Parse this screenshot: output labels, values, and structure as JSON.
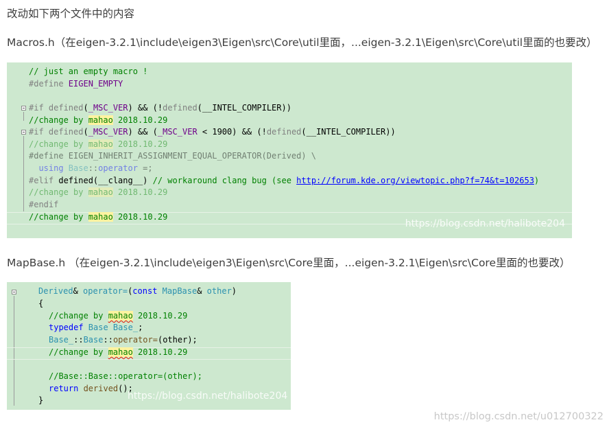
{
  "intro": "改动如下两个文件中的内容",
  "file1": {
    "heading": "Macros.h（在eigen-3.2.1\\include\\eigen3\\Eigen\\src\\Core\\util里面，...eigen-3.2.1\\Eigen\\src\\Core\\util里面的也要改）",
    "code": {
      "l1": "// just an empty macro !",
      "l2_kw": "#define",
      "l2_name": " EIGEN_EMPTY",
      "l4_kw": "#if",
      "l4_def": " defined",
      "l4_a": "(",
      "l4_m1": "_MSC_VER",
      "l4_b": ") && (!",
      "l4_def2": "defined",
      "l4_c": "(__INTEL_COMPILER))",
      "l5_a": "//change by ",
      "l5_hl": "mahao",
      "l5_b": " 2018.10.29",
      "l6_kw": "#if",
      "l6_def": " defined",
      "l6_a": "(",
      "l6_m1": "_MSC_VER",
      "l6_b": ") && (",
      "l6_m2": "_MSC_VER",
      "l6_c": " < 1900) && (!",
      "l6_def2": "defined",
      "l6_d": "(__INTEL_COMPILER))",
      "l7_a": "//change by ",
      "l7_hl": "mahao",
      "l7_b": " 2018.10.29",
      "l8": "#define EIGEN_INHERIT_ASSIGNMENT_EQUAL_OPERATOR(Derived) \\",
      "l9_kw": "  using",
      "l9_type": " Base",
      "l9_a": "::",
      "l9_fn": "operator",
      "l9_b": " =;",
      "l10_kw": "#elif",
      "l10_a": " defined(__clang__) ",
      "l10_cm": "// workaround clang bug (see ",
      "l10_link": "http://forum.kde.org/viewtopic.php?f=74&t=102653",
      "l10_end": ")",
      "l11_a": "//change by ",
      "l11_hl": "mahao",
      "l11_b": " 2018.10.29",
      "l12": "#endif",
      "l13_a": "//change by ",
      "l13_hl": "mahao",
      "l13_b": " 2018.10.29"
    },
    "watermark": "https://blog.csdn.net/halibote204"
  },
  "file2": {
    "heading": "MapBase.h （在eigen-3.2.1\\include\\eigen3\\Eigen\\src\\Core里面，...eigen-3.2.1\\Eigen\\src\\Core里面的也要改）",
    "code": {
      "l1_type": "Derived",
      "l1_a": "& ",
      "l1_fn": "operator=",
      "l1_b": "(",
      "l1_kw": "const",
      "l1_type2": " MapBase",
      "l1_c": "& ",
      "l1_param": "other",
      "l1_d": ")",
      "l2": "{",
      "l3_a": "//change by ",
      "l3_w": "mahao",
      "l3_b": " 2018.10.29",
      "l4_kw": "typedef",
      "l4_type": " Base",
      "l4_type2": " Base_",
      "l4_a": ";",
      "l5_type": "Base_",
      "l5_a": "::",
      "l5_type2": "Base",
      "l5_b": "::",
      "l5_fn": "operator=",
      "l5_c": "(other);",
      "l6_a": "//change by ",
      "l6_w": "mahao",
      "l6_b": " 2018.10.29",
      "l8": "//Base::Base::operator=(other);",
      "l9_kw": "return",
      "l9_fn": " derived",
      "l9_a": "();",
      "l10": "}"
    },
    "watermark": "https://blog.csdn.net/halibote204"
  },
  "page_watermark": "https://blog.csdn.net/u012700322"
}
